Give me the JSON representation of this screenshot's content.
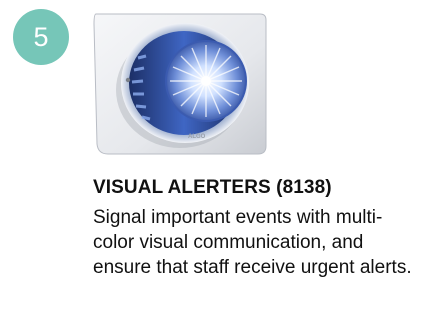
{
  "step": {
    "number": "5",
    "badge_color": "#76c6b8"
  },
  "product": {
    "image_icon": "visual-alerter-device-icon",
    "brand_mark": "ALGO"
  },
  "heading": "VISUAL ALERTERS (8138)",
  "description": "Signal important events with multi-color visual communication, and ensure that staff receive urgent alerts."
}
